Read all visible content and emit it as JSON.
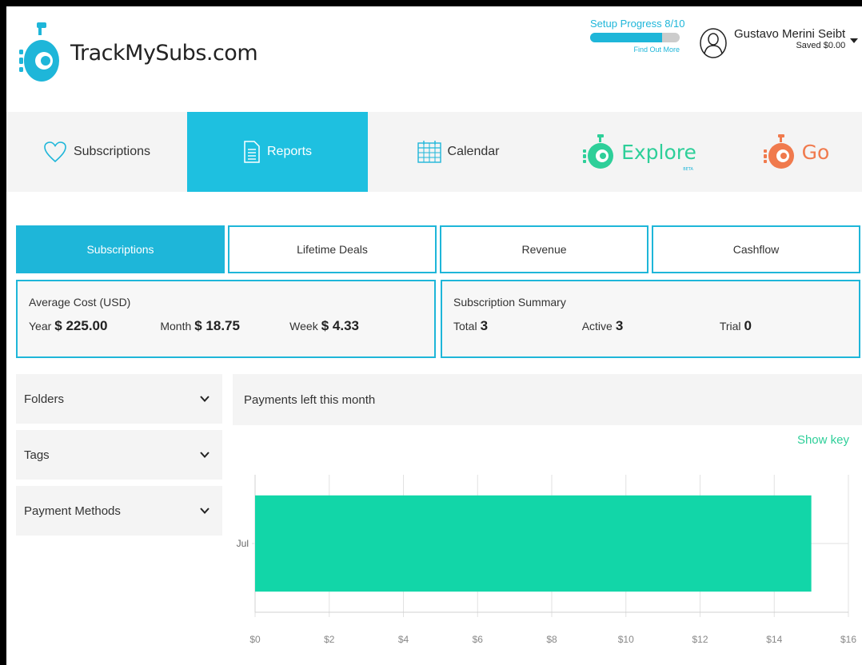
{
  "app": {
    "name": "TrackMySubs.com"
  },
  "setup": {
    "label": "Setup Progress 8/10",
    "progress": 0.8,
    "link": "Find Out More"
  },
  "user": {
    "name": "Gustavo Merini Seibt",
    "saved": "Saved $0.00"
  },
  "nav": {
    "subscriptions": "Subscriptions",
    "reports": "Reports",
    "calendar": "Calendar",
    "explore": "Explore",
    "explore_badge": "BETA",
    "go": "Go"
  },
  "tabs": [
    "Subscriptions",
    "Lifetime Deals",
    "Revenue",
    "Cashflow"
  ],
  "avg_cost": {
    "title": "Average Cost (USD)",
    "year_label": "Year",
    "year_value": "$ 225.00",
    "month_label": "Month",
    "month_value": "$ 18.75",
    "week_label": "Week",
    "week_value": "$ 4.33"
  },
  "summary": {
    "title": "Subscription Summary",
    "total_label": "Total",
    "total_value": "3",
    "active_label": "Active",
    "active_value": "3",
    "trial_label": "Trial",
    "trial_value": "0"
  },
  "filters": [
    "Folders",
    "Tags",
    "Payment Methods"
  ],
  "panel": {
    "title": "Payments left this month",
    "show_key": "Show key"
  },
  "colors": {
    "accent": "#1eb6d9",
    "bar": "#12d6a8",
    "explore": "#2ecf99",
    "go": "#f07a4d"
  },
  "chart_data": {
    "type": "bar",
    "orientation": "horizontal",
    "categories": [
      "Jul"
    ],
    "values": [
      15
    ],
    "xlim": [
      0,
      16
    ],
    "xticks": [
      "$0",
      "$2",
      "$4",
      "$6",
      "$8",
      "$10",
      "$12",
      "$14",
      "$16"
    ],
    "grid": true
  }
}
